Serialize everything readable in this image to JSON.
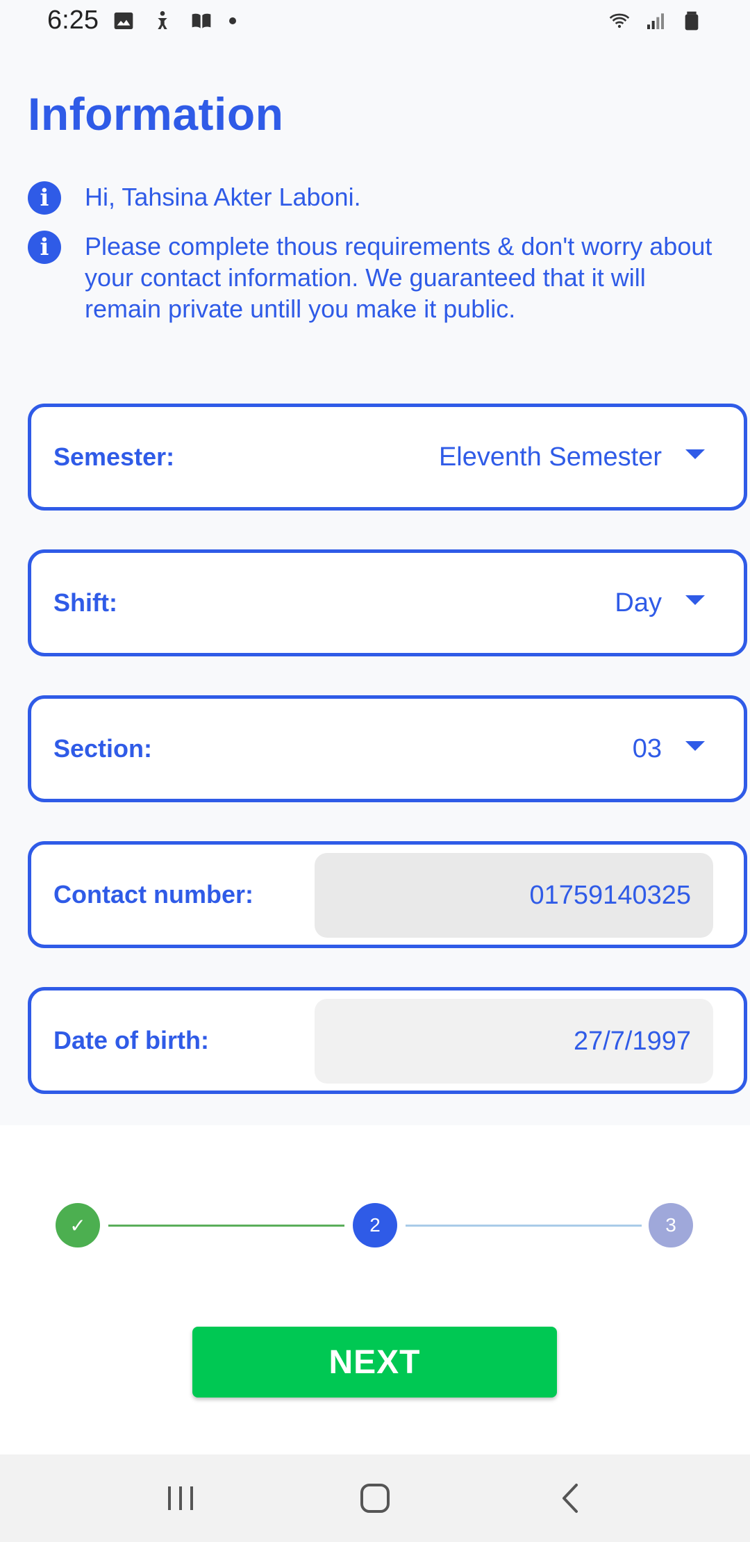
{
  "status_bar": {
    "time": "6:25",
    "left_icons": [
      "image-icon",
      "accessibility-icon",
      "book-icon",
      "dot-icon"
    ],
    "right_icons": [
      "wifi-icon",
      "signal-icon",
      "battery-icon"
    ]
  },
  "page": {
    "title": "Information",
    "greeting": "Hi, Tahsina Akter Laboni.",
    "notice": "Please complete thous requirements & don't worry about your contact information. We guaranteed that it will remain private untill you make it public."
  },
  "fields": {
    "semester": {
      "label": "Semester:",
      "value": "Eleventh Semester"
    },
    "shift": {
      "label": "Shift:",
      "value": "Day"
    },
    "section": {
      "label": "Section:",
      "value": "03"
    },
    "contact": {
      "label": "Contact number:",
      "value": "01759140325"
    },
    "dob": {
      "label": "Date of birth:",
      "value": "27/7/1997"
    }
  },
  "stepper": {
    "step1": "✓",
    "step2": "2",
    "step3": "3",
    "completed_color": "#4caf50",
    "current_color": "#2f5be7",
    "pending_color": "#9fa8da"
  },
  "actions": {
    "next_label": "NEXT"
  },
  "colors": {
    "accent": "#2f5be7",
    "button": "#00c853"
  },
  "nav_bar": {
    "icons": [
      "recent-apps-icon",
      "home-icon",
      "back-icon"
    ]
  }
}
